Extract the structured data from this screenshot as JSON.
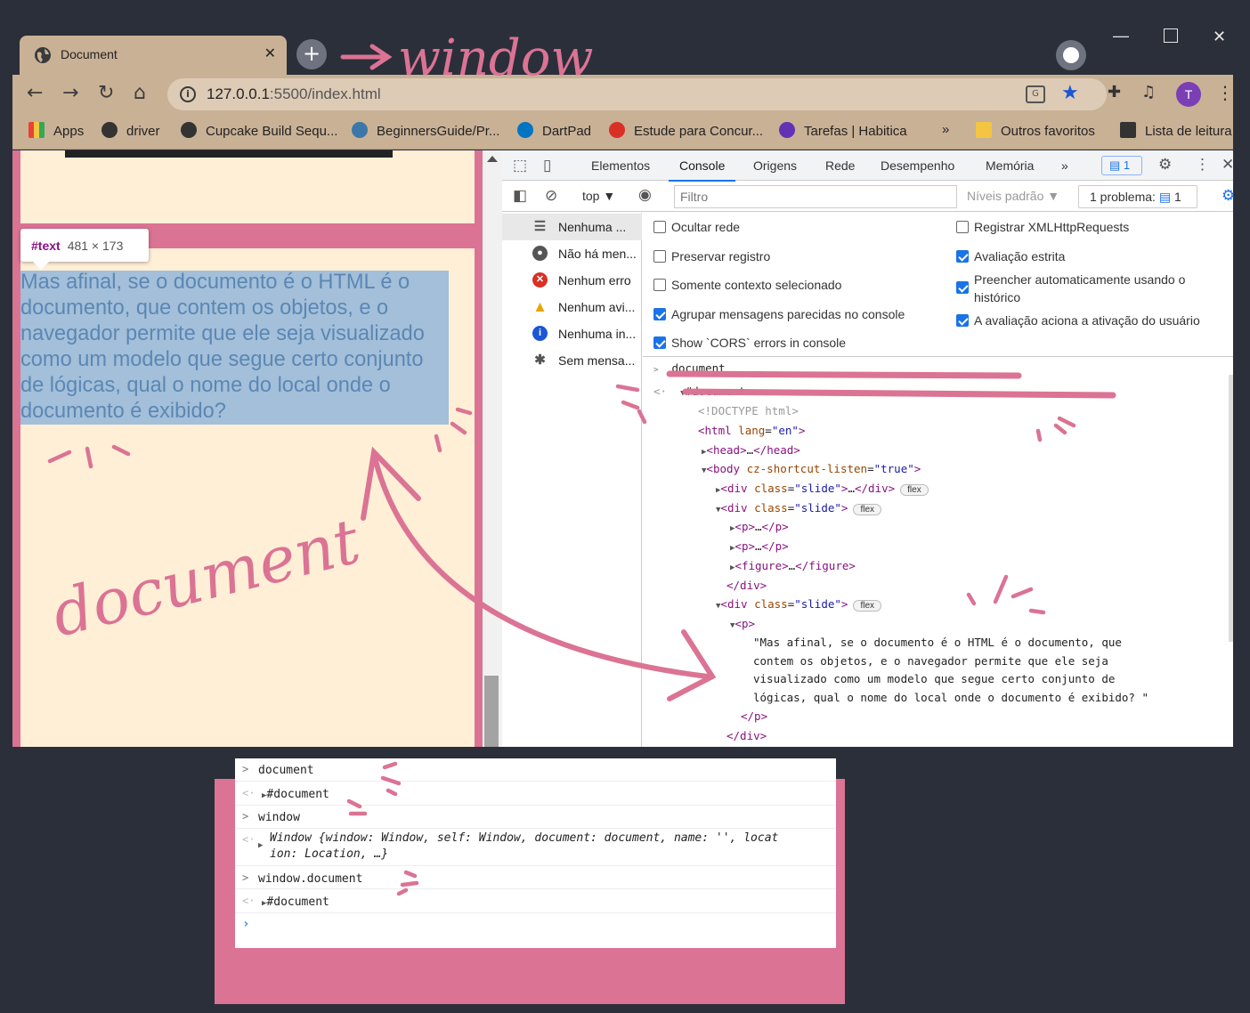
{
  "browser": {
    "tab_title": "Document",
    "url_host": "127.0.0.1",
    "url_path": ":5500/index.html",
    "avatar_letter": "T"
  },
  "bookmarks": [
    {
      "label": "Apps",
      "color": "#e94235"
    },
    {
      "label": "driver",
      "color": "#333333"
    },
    {
      "label": "Cupcake Build Sequ...",
      "color": "#333333"
    },
    {
      "label": "BeginnersGuide/Pr...",
      "color": "#3b77a8"
    },
    {
      "label": "DartPad",
      "color": "#0175c2"
    },
    {
      "label": "Estude para Concur...",
      "color": "#d93025"
    },
    {
      "label": "Tarefas | Habitica",
      "color": "#6133b4"
    },
    {
      "label": "»",
      "color": ""
    },
    {
      "label": "Outros favoritos",
      "color": "#f4c542"
    },
    {
      "label": "Lista de leitura",
      "color": "#333333"
    }
  ],
  "page": {
    "tooltip_tag": "#text",
    "tooltip_size": "481 × 173",
    "paragraph": "Mas afinal, se o documento é o HTML é o documento, que contem os objetos, e o navegador permite que ele seja visualizado como um modelo que segue certo conjunto de lógicas, qual o nome do local onde o documento é exibido?"
  },
  "devtools": {
    "tabs": [
      "Elementos",
      "Console",
      "Origens",
      "Rede",
      "Desempenho",
      "Memória",
      "»"
    ],
    "active_tab": "Console",
    "issues_badge": "1",
    "context": "top ▼",
    "filter_placeholder": "Filtro",
    "levels": "Níveis padrão ▼",
    "problems": "1 problema:",
    "problems_count": "1",
    "sidebar": [
      {
        "label": "Nenhuma ...",
        "icon": "list-icon"
      },
      {
        "label": "Não há men...",
        "icon": "user-icon"
      },
      {
        "label": "Nenhum erro",
        "icon": "error-icon"
      },
      {
        "label": "Nenhum avi...",
        "icon": "warning-icon"
      },
      {
        "label": "Nenhuma in...",
        "icon": "info-icon"
      },
      {
        "label": "Sem mensa...",
        "icon": "bug-icon"
      }
    ],
    "settings_left": [
      {
        "label": "Ocultar rede",
        "checked": false
      },
      {
        "label": "Preservar registro",
        "checked": false
      },
      {
        "label": "Somente contexto selecionado",
        "checked": false
      },
      {
        "label": "Agrupar mensagens parecidas no console",
        "checked": true
      },
      {
        "label": "Show `CORS` errors in console",
        "checked": true
      }
    ],
    "settings_right": [
      {
        "label": "Registrar XMLHttpRequests",
        "checked": false
      },
      {
        "label": "Avaliação estrita",
        "checked": true
      },
      {
        "label": "Preencher automaticamente usando o histórico",
        "checked": true
      },
      {
        "label": "A avaliação aciona a ativação do usuário",
        "checked": true
      }
    ],
    "console": {
      "input": "document",
      "output": "#document",
      "doctype": "<!DOCTYPE html>",
      "html_open": "html",
      "html_attr": "lang",
      "html_val": "\"en\"",
      "head": "head",
      "body_attr": "cz-shortcut-listen",
      "body_val": "\"true\"",
      "div_class_val": "\"slide\"",
      "pill": "flex",
      "p_text_lines": [
        "\"Mas afinal, se o documento é o HTML é o documento, que",
        "contem os objetos, e o navegador permite que ele seja",
        "visualizado como um modelo que segue certo conjunto de",
        "lógicas, qual o nome do local onde o documento é exibido? \""
      ]
    }
  },
  "bottom_console": {
    "rows": [
      {
        "kind": "input",
        "text": "document"
      },
      {
        "kind": "output",
        "text": "#document"
      },
      {
        "kind": "input",
        "text": "window"
      },
      {
        "kind": "output_obj",
        "line1": "Window {window: Window, self: Window, document: document, name: '', locat",
        "line2": "ion: Location, …}"
      },
      {
        "kind": "input",
        "text": "window.document"
      },
      {
        "kind": "output",
        "text": "#document"
      }
    ]
  },
  "annotations": {
    "window_label": "window",
    "document_label": "document",
    "color": "#db7394"
  }
}
